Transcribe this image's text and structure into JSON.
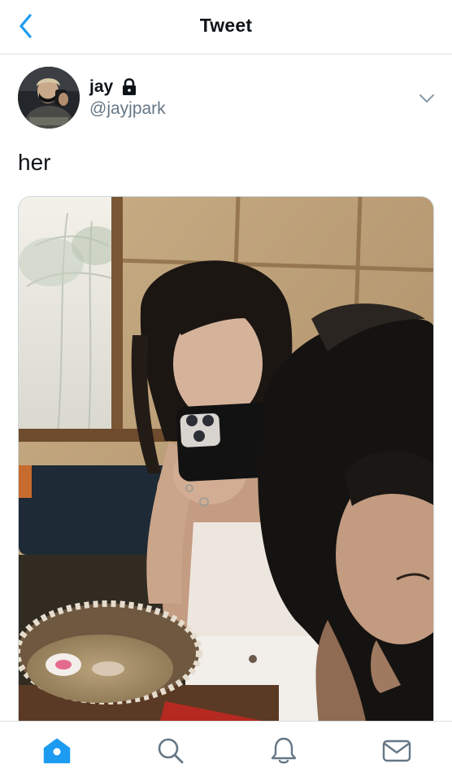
{
  "header": {
    "title": "Tweet",
    "back_icon": "chevron-left-icon"
  },
  "tweet": {
    "author": {
      "name": "jay",
      "handle": "@jayjpark",
      "protected_icon": "lock-icon"
    },
    "menu_icon": "chevron-down-icon",
    "text": "her",
    "media_icon": "photo"
  },
  "tabbar": {
    "items": [
      {
        "icon": "home-icon",
        "active": true
      },
      {
        "icon": "search-icon",
        "active": false
      },
      {
        "icon": "bell-icon",
        "active": false
      },
      {
        "icon": "mail-icon",
        "active": false
      }
    ]
  },
  "colors": {
    "accent": "#1d9bf0",
    "text": "#0f1419",
    "secondary": "#657786",
    "icon": "#657786",
    "border": "#d9dfe3"
  }
}
